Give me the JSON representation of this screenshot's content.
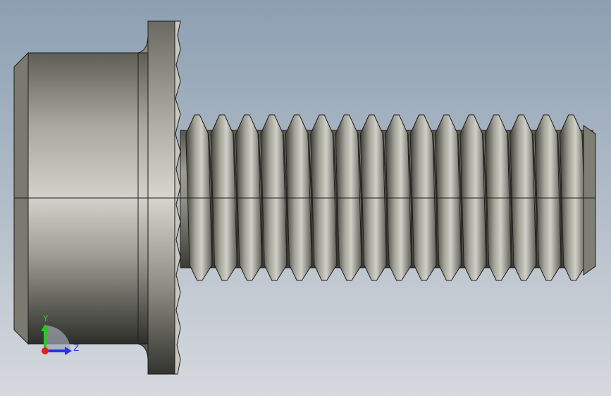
{
  "viewport": {
    "background_top": "#8c9fb2",
    "background_bottom": "#d3d7dd",
    "model": "hex-flange-bolt",
    "thread_count": 16
  },
  "colors": {
    "metal_light": "#cfcfc9",
    "metal_mid": "#9a9a90",
    "metal_dark": "#4a4a44",
    "edge": "#1e1e1a"
  },
  "triad": {
    "y_label": "Y",
    "z_label": "Z",
    "y_color": "#22cc22",
    "z_color": "#2233ee",
    "x_color": "#e02020"
  }
}
